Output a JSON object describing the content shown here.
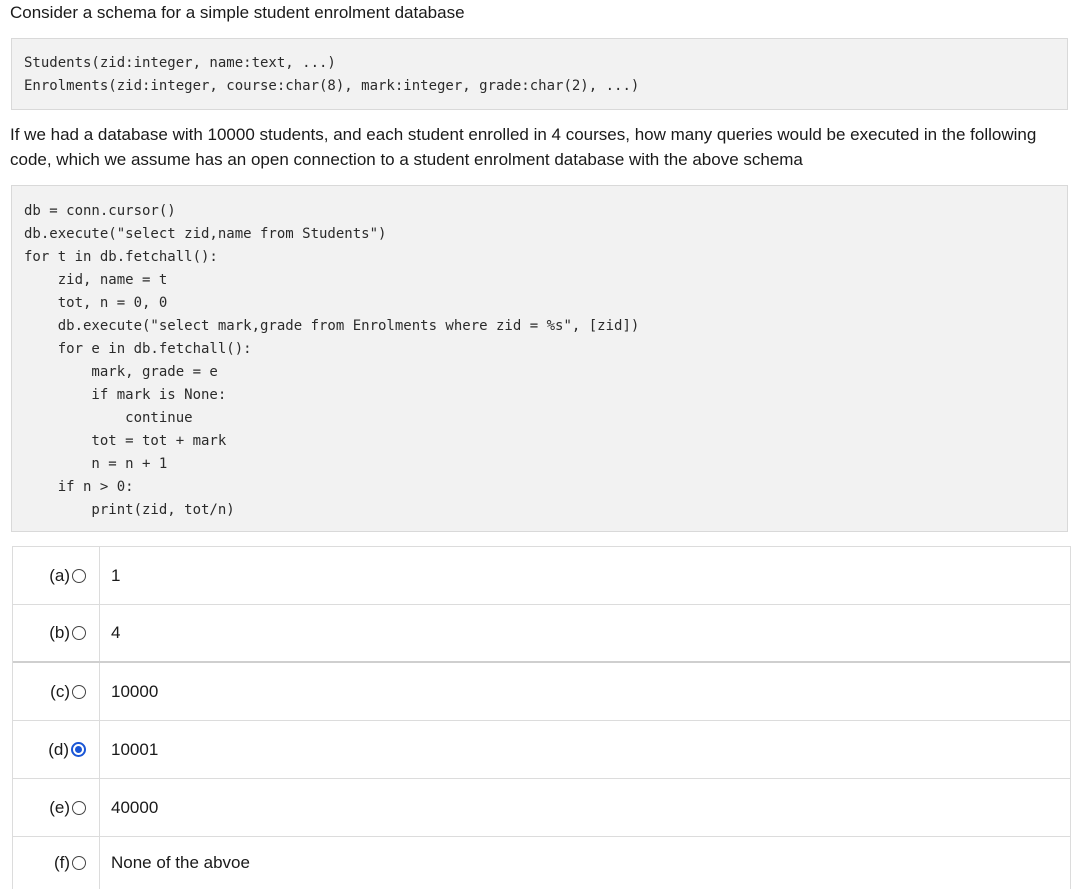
{
  "intro": "Consider a schema for a simple student enrolment database",
  "schema": [
    "Students(zid:integer, name:text, ...)",
    "Enrolments(zid:integer, course:char(8), mark:integer, grade:char(2), ...)"
  ],
  "question_lines": [
    "If we had a database with 10000 students, and each student enrolled in 4 courses, how many queries would be executed in the following",
    "code, which we assume has an open connection to a student enrolment database with the above schema"
  ],
  "code": [
    "db = conn.cursor()",
    "db.execute(\"select zid,name from Students\")",
    "for t in db.fetchall():",
    "    zid, name = t",
    "    tot, n = 0, 0",
    "    db.execute(\"select mark,grade from Enrolments where zid = %s\", [zid])",
    "    for e in db.fetchall():",
    "        mark, grade = e",
    "        if mark is None:",
    "            continue",
    "        tot = tot + mark",
    "        n = n + 1",
    "    if n > 0:",
    "        print(zid, tot/n)"
  ],
  "options": [
    {
      "letter": "(a)",
      "text": "1",
      "checked": false
    },
    {
      "letter": "(b)",
      "text": "4",
      "checked": false
    },
    {
      "letter": "(c)",
      "text": "10000",
      "checked": false
    },
    {
      "letter": "(d)",
      "text": "10001",
      "checked": true
    },
    {
      "letter": "(e)",
      "text": "40000",
      "checked": false
    },
    {
      "letter": "(f)",
      "text": "None of the abvoe",
      "checked": false
    }
  ],
  "colors": {
    "selected_radio": "#1a56d6",
    "code_background": "#f2f2f2"
  }
}
